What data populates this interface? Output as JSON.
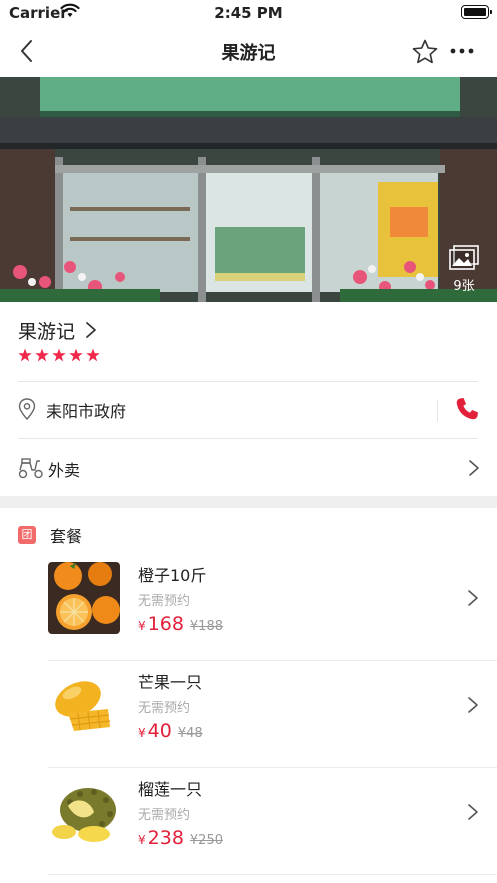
{
  "status_bar": {
    "carrier": "Carrier",
    "time": "2:45 PM"
  },
  "nav": {
    "title": "果游记"
  },
  "hero": {
    "photo_count": "9张"
  },
  "shop": {
    "name": "果游记",
    "rating": 5,
    "address": "耒阳市政府",
    "delivery_label": "外卖"
  },
  "packages": {
    "badge": "团",
    "title": "套餐",
    "items": [
      {
        "name": "橙子10斤",
        "note": "无需预约",
        "currency": "¥",
        "price": "168",
        "original": "¥188",
        "image": "orange-icon"
      },
      {
        "name": "芒果一只",
        "note": "无需预约",
        "currency": "¥",
        "price": "40",
        "original": "¥48",
        "image": "mango-icon"
      },
      {
        "name": "榴莲一只",
        "note": "无需预约",
        "currency": "¥",
        "price": "238",
        "original": "¥250",
        "image": "durian-icon"
      }
    ]
  },
  "colors": {
    "accent": "#e2203a",
    "badge": "#f26b6b",
    "star": "#f0284a"
  }
}
